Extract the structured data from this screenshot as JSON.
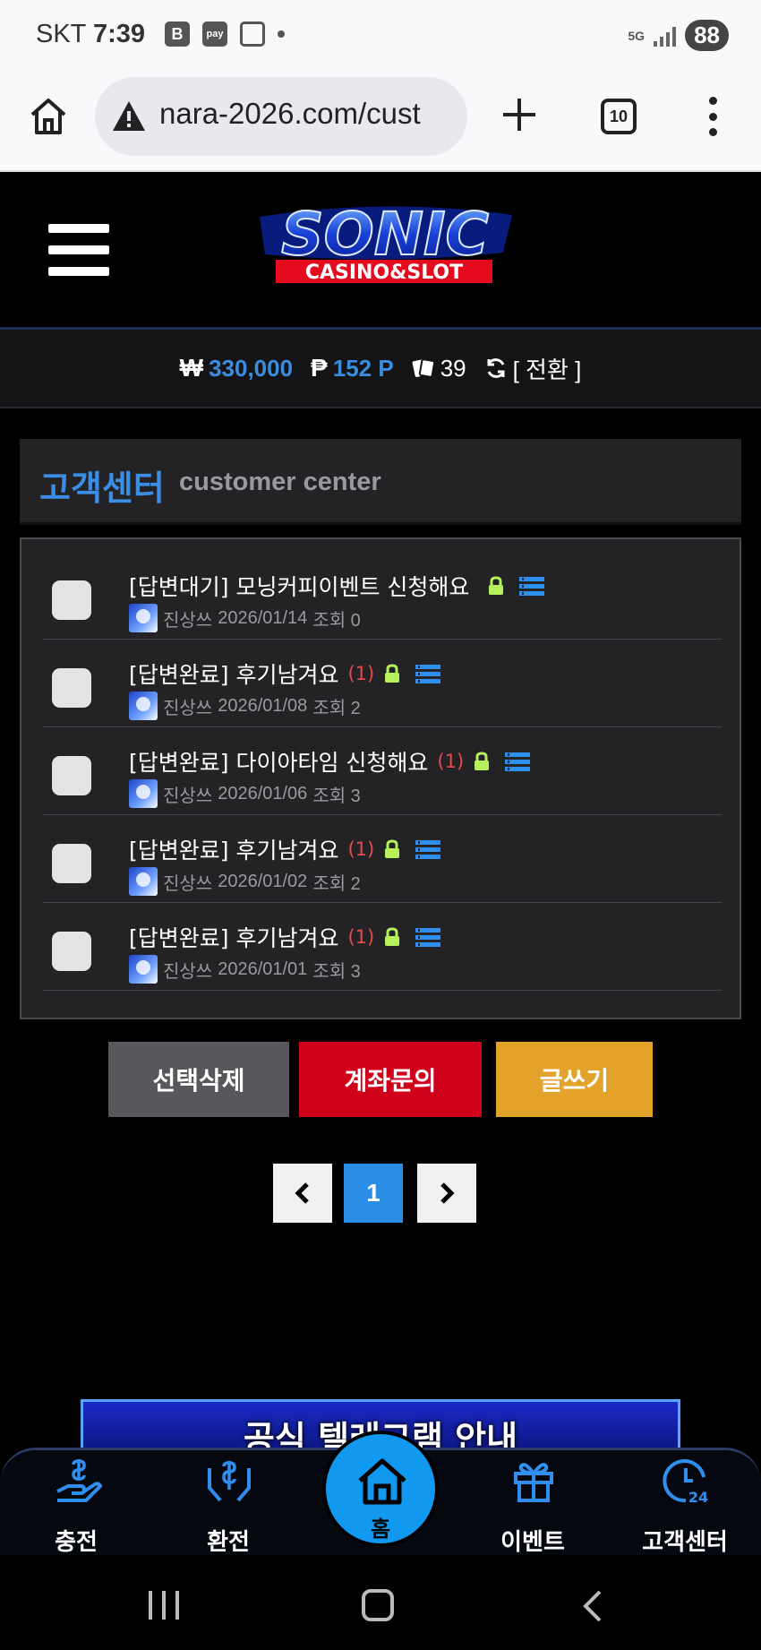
{
  "status_bar": {
    "carrier": "SKT",
    "time": "7:39",
    "icons": [
      "b-icon",
      "pay-icon",
      "screenshot-icon",
      "dot-icon"
    ],
    "network": "5G",
    "battery": "88"
  },
  "browser": {
    "url": "nara-2026.com/cust",
    "tab_count": "10"
  },
  "balance": {
    "won_symbol": "₩",
    "won_value": "330,000",
    "point_symbol": "₱",
    "point_value": "152 P",
    "ticket_value": "39",
    "switch_label": "[ 전환 ]"
  },
  "section": {
    "title_ko": "고객센터",
    "title_en": "customer center"
  },
  "posts": [
    {
      "title": "[답변대기] 모닝커피이벤트 신청해요",
      "count": "",
      "author": "진상쓰",
      "date": "2026/01/14",
      "views": "조회 0"
    },
    {
      "title": "[답변완료] 후기남겨요",
      "count": "(1)",
      "author": "진상쓰",
      "date": "2026/01/08",
      "views": "조회 2"
    },
    {
      "title": "[답변완료] 다이아타임 신청해요",
      "count": "(1)",
      "author": "진상쓰",
      "date": "2026/01/06",
      "views": "조회 3"
    },
    {
      "title": "[답변완료] 후기남겨요",
      "count": "(1)",
      "author": "진상쓰",
      "date": "2026/01/02",
      "views": "조회 2"
    },
    {
      "title": "[답변완료] 후기남겨요",
      "count": "(1)",
      "author": "진상쓰",
      "date": "2026/01/01",
      "views": "조회 3"
    }
  ],
  "actions": {
    "delete_selected": "선택삭제",
    "account_inquiry": "계좌문의",
    "write": "글쓰기"
  },
  "pagination": {
    "current": "1"
  },
  "banner": {
    "text": "공식 텔레그램 안내"
  },
  "bottom_nav": {
    "deposit": "충전",
    "withdraw": "환전",
    "home": "홈",
    "event": "이벤트",
    "support": "고객센터"
  },
  "colors": {
    "accent_blue": "#3b8ee6",
    "danger_red": "#d0021b",
    "gold": "#e3a22a",
    "panel": "#232325"
  }
}
